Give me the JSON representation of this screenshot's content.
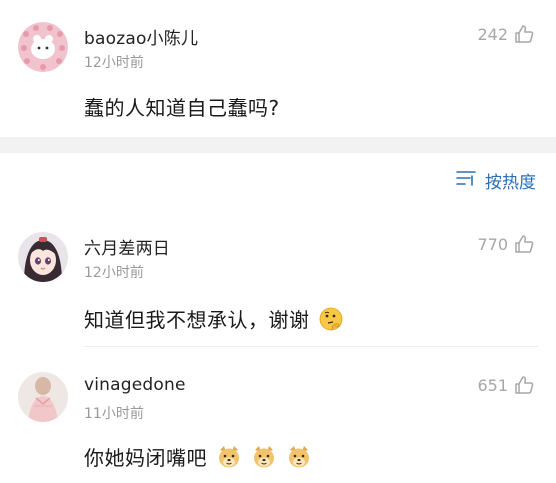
{
  "top_comment": {
    "username": "baozao小陈儿",
    "time": "12小时前",
    "likes": "242",
    "text": "蠢的人知道自己蠢吗?"
  },
  "sort": {
    "label": "按热度",
    "icon": "sort-lines-icon",
    "color": "#2d6fb3"
  },
  "comments": [
    {
      "username": "六月差两日",
      "time": "12小时前",
      "likes": "770",
      "text": "知道但我不想承认，谢谢",
      "emoji": "thinking-face-icon"
    },
    {
      "username": "vinagedone",
      "time": "11小时前",
      "likes": "651",
      "text": "你她妈闭嘴吧",
      "emoji": "doge-face-icon"
    }
  ]
}
